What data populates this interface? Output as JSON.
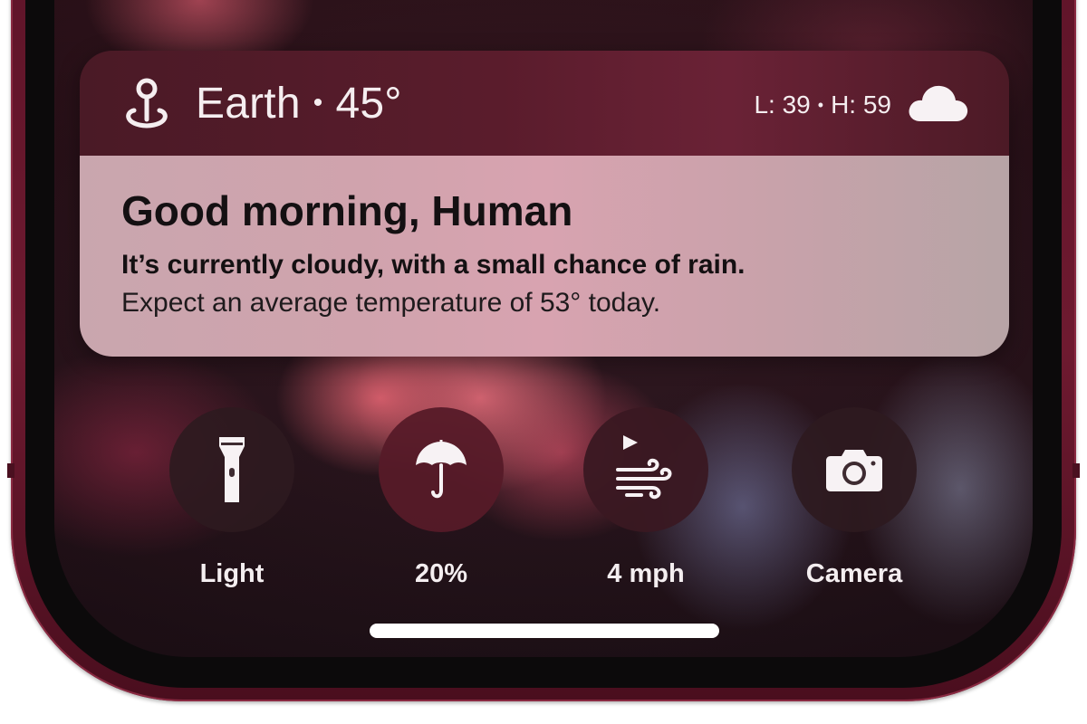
{
  "widget": {
    "location": "Earth",
    "separator": "•",
    "temperature": "45°",
    "low": "L: 39",
    "high": "H: 59",
    "greeting": "Good morning, Human",
    "summary": "It’s currently cloudy, with a small chance of rain.",
    "forecast": "Expect an average temperature of 53° today.",
    "location_icon": "location-pin-icon",
    "weather_icon": "cloud-icon"
  },
  "actions": [
    {
      "label": "Light",
      "icon": "flashlight-icon"
    },
    {
      "label": "20%",
      "icon": "umbrella-icon"
    },
    {
      "label": "4 mph",
      "icon": "wind-icon"
    },
    {
      "label": "Camera",
      "icon": "camera-icon"
    }
  ],
  "colors": {
    "phone_frame": "#6e1a30",
    "widget_header": "#5a1c2c",
    "widget_body": "#d0a3ad",
    "text_light": "#f5eef0"
  }
}
